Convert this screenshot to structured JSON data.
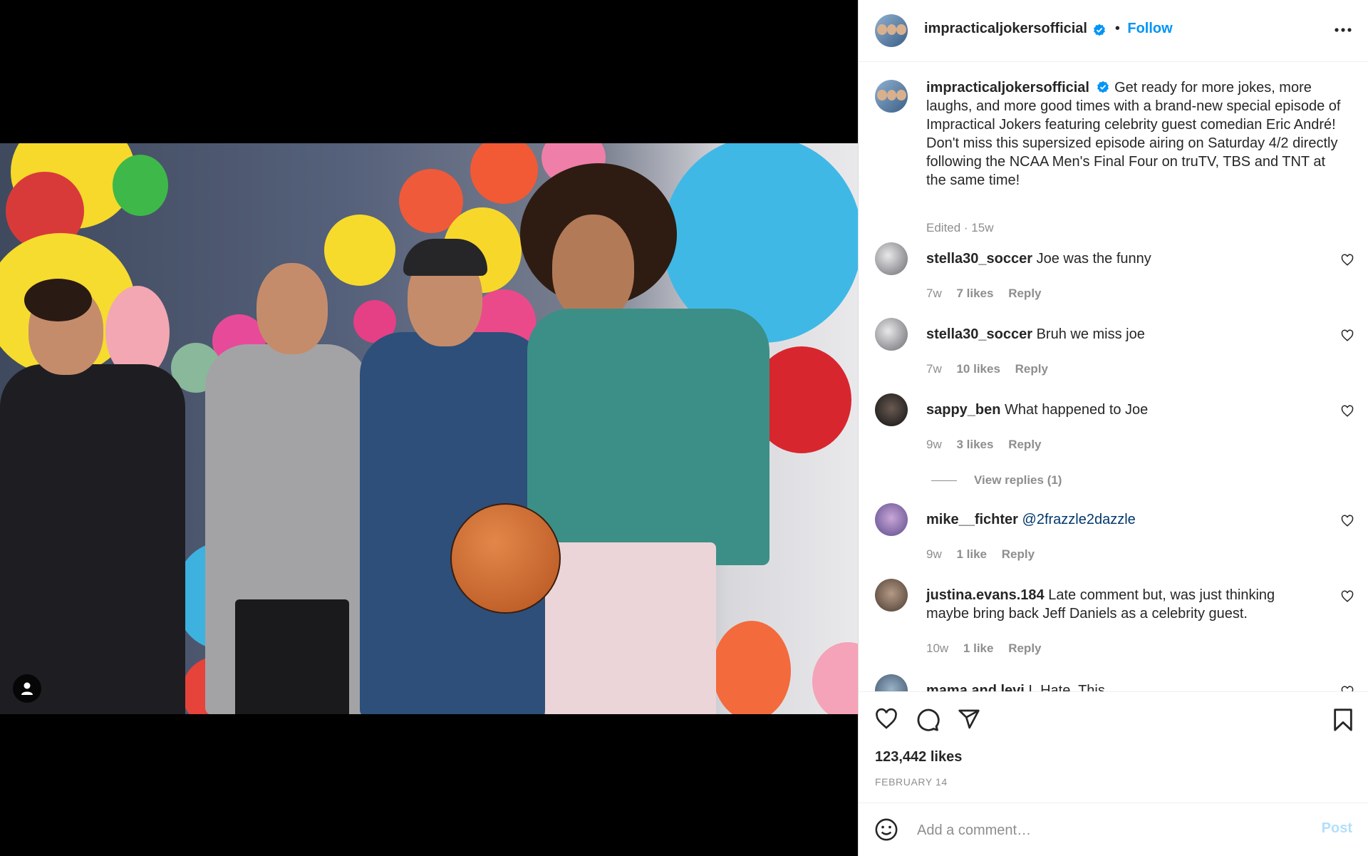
{
  "post": {
    "media": {
      "type": "photo",
      "user_tag_icon": "user-icon"
    },
    "header": {
      "username": "impracticaljokersofficial",
      "separator": "•",
      "follow_label": "Follow",
      "more_icon": "more-horizontal-icon"
    },
    "caption": {
      "username": "impracticaljokersofficial",
      "text": "Get ready for more jokes, more laughs, and more good times with a brand-new special episode of Impractical Jokers featuring celebrity guest comedian Eric André! Don't miss this supersized episode airing on Saturday 4/2 directly following the NCAA Men's Final Four on truTV, TBS and TNT at the same time!",
      "meta": "Edited · 15w"
    },
    "comments": [
      {
        "username": "stella30_soccer",
        "text": "Joe was the funny",
        "time": "7w",
        "likes": "7 likes",
        "reply": "Reply"
      },
      {
        "username": "stella30_soccer",
        "text": "Bruh we miss joe",
        "time": "7w",
        "likes": "10 likes",
        "reply": "Reply"
      },
      {
        "username": "sappy_ben",
        "text": "What happened to Joe",
        "time": "9w",
        "likes": "3 likes",
        "reply": "Reply",
        "view_replies": "View replies (1)"
      },
      {
        "username": "mike__fichter",
        "text": "@2frazzle2dazzle",
        "time": "9w",
        "likes": "1 like",
        "reply": "Reply"
      },
      {
        "username": "justina.evans.184",
        "text": "Late comment but, was just thinking maybe bring back Jeff Daniels as a celebrity guest.",
        "time": "10w",
        "likes": "1 like",
        "reply": "Reply"
      },
      {
        "username": "mama.and.levi",
        "text": "I. Hate. This."
      }
    ],
    "actions": {
      "like_icon": "heart-icon",
      "comment_icon": "comment-icon",
      "share_icon": "send-icon",
      "save_icon": "bookmark-icon",
      "likes": "123,442 likes",
      "date": "FEBRUARY 14"
    },
    "add_comment": {
      "emoji_icon": "emoji-icon",
      "placeholder": "Add a comment…",
      "post_label": "Post"
    }
  },
  "colors": {
    "follow": "#0095f6",
    "verified": "#0095f6",
    "post_disabled": "#b2dffc",
    "meta_gray": "#8e8e8e",
    "mention": "#00376b"
  }
}
